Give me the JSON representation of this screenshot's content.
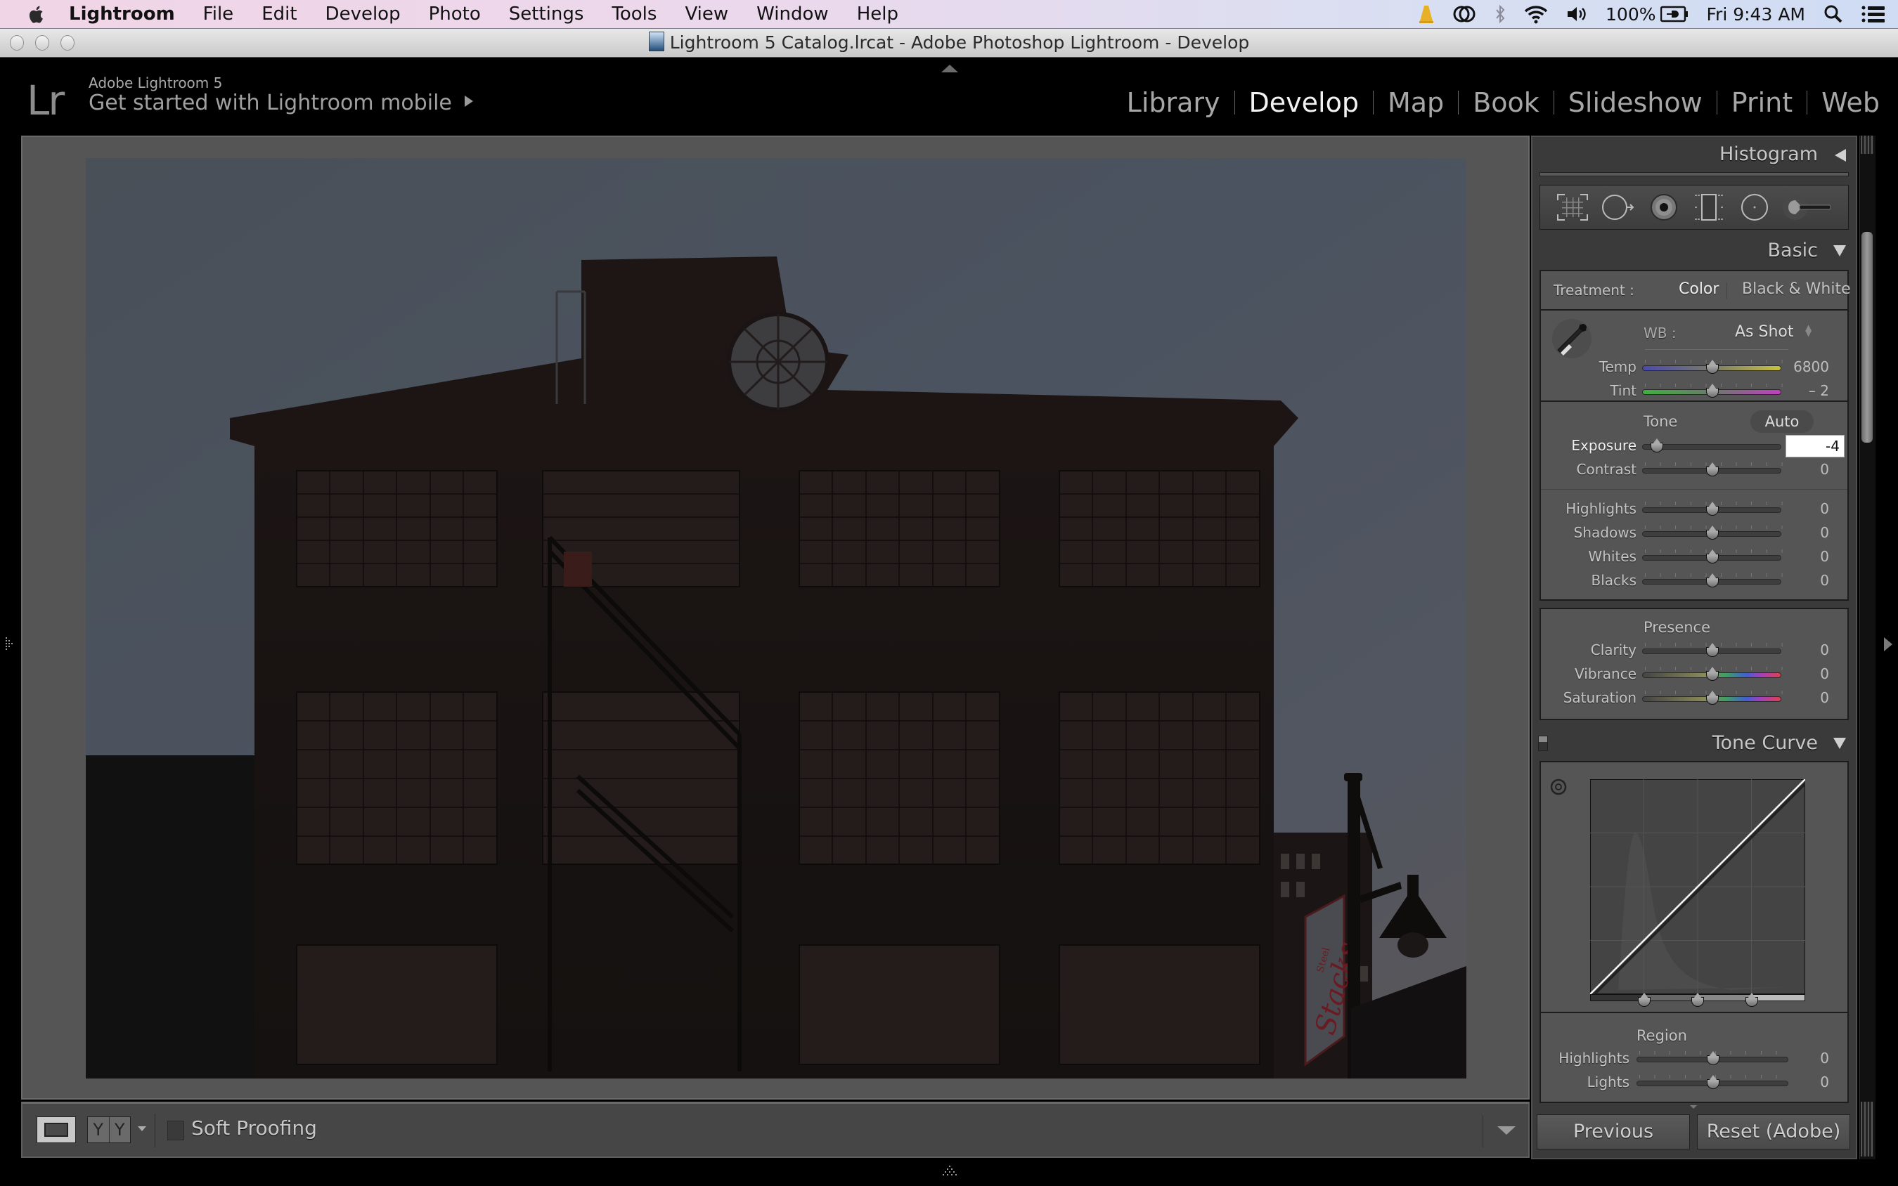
{
  "menubar": {
    "app_name": "Lightroom",
    "items": [
      "File",
      "Edit",
      "Develop",
      "Photo",
      "Settings",
      "Tools",
      "View",
      "Window",
      "Help"
    ],
    "status": {
      "battery": "100%",
      "clock": "Fri 9:43 AM",
      "icons": [
        "vlc-cone-icon",
        "creative-cloud-icon",
        "bluetooth-icon",
        "wifi-icon",
        "volume-icon",
        "battery-charging-icon",
        "spotlight-search-icon",
        "notification-center-icon"
      ]
    }
  },
  "window": {
    "title": "Lightroom 5 Catalog.lrcat - Adobe Photoshop Lightroom - Develop"
  },
  "header": {
    "logo": "Lr",
    "product": "Adobe Lightroom 5",
    "mobile_prompt": "Get started with Lightroom mobile",
    "modules": [
      {
        "label": "Library",
        "active": false
      },
      {
        "label": "Develop",
        "active": true
      },
      {
        "label": "Map",
        "active": false
      },
      {
        "label": "Book",
        "active": false
      },
      {
        "label": "Slideshow",
        "active": false
      },
      {
        "label": "Print",
        "active": false
      },
      {
        "label": "Web",
        "active": false
      }
    ]
  },
  "photo": {
    "description": "Dark underexposed photo of brick industrial building with circular window, fire escape and street lamp with Steel Stacks banner",
    "banner_text_small": "Steel",
    "banner_text": "Stacks"
  },
  "toolbar": {
    "view_loupe": "loupe-view",
    "compare_labels": [
      "Y",
      "Y"
    ],
    "soft_proofing_label": "Soft Proofing",
    "soft_proofing_checked": false
  },
  "panel": {
    "histogram": {
      "title": "Histogram"
    },
    "tools": [
      "crop-overlay-tool",
      "spot-removal-tool",
      "red-eye-tool",
      "graduated-filter-tool",
      "radial-filter-tool",
      "adjustment-brush-tool"
    ],
    "basic": {
      "title": "Basic",
      "treatment_label": "Treatment :",
      "treatment_options": [
        "Color",
        "Black & White"
      ],
      "treatment_selected": "Color",
      "wb_label": "WB :",
      "wb_value": "As Shot",
      "temp": {
        "label": "Temp",
        "value": "6800",
        "position": 0.5
      },
      "tint": {
        "label": "Tint",
        "value": "– 2",
        "position": 0.5
      },
      "tone_label": "Tone",
      "auto_label": "Auto",
      "exposure": {
        "label": "Exposure",
        "value": "-4",
        "position": 0.1
      },
      "contrast": {
        "label": "Contrast",
        "value": "0",
        "position": 0.5
      },
      "highlights": {
        "label": "Highlights",
        "value": "0",
        "position": 0.5
      },
      "shadows": {
        "label": "Shadows",
        "value": "0",
        "position": 0.5
      },
      "whites": {
        "label": "Whites",
        "value": "0",
        "position": 0.5
      },
      "blacks": {
        "label": "Blacks",
        "value": "0",
        "position": 0.5
      },
      "presence_label": "Presence",
      "clarity": {
        "label": "Clarity",
        "value": "0",
        "position": 0.5
      },
      "vibrance": {
        "label": "Vibrance",
        "value": "0",
        "position": 0.5
      },
      "saturation": {
        "label": "Saturation",
        "value": "0",
        "position": 0.5
      }
    },
    "tone_curve": {
      "title": "Tone Curve",
      "split_points": [
        0.25,
        0.5,
        0.75
      ],
      "region_label": "Region",
      "highlights": {
        "label": "Highlights",
        "value": "0",
        "position": 0.5
      },
      "lights": {
        "label": "Lights",
        "value": "0",
        "position": 0.5
      }
    },
    "previous_label": "Previous",
    "reset_label": "Reset (Adobe)"
  }
}
